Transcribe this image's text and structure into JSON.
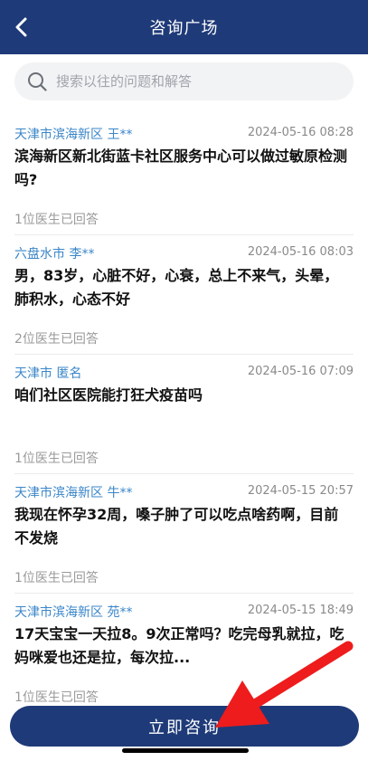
{
  "header": {
    "title": "咨询广场",
    "back_icon": "chevron-left-icon"
  },
  "search": {
    "placeholder": "搜索以往的问题和解答",
    "icon": "search-icon"
  },
  "questions": [
    {
      "location": "天津市滨海新区 王**",
      "time": "2024-05-16 08:28",
      "question": "滨海新区新北街蓝卡社区服务中心可以做过敏原检测吗?",
      "answers": "1位医生已回答"
    },
    {
      "location": "六盘水市 李**",
      "time": "2024-05-16 08:03",
      "question": "男，83岁，心脏不好，心衰，总上不来气，头晕，肺积水，心态不好",
      "answers": "2位医生已回答"
    },
    {
      "location": "天津市 匿名",
      "time": "2024-05-16 07:09",
      "question": "咱们社区医院能打狂犬疫苗吗",
      "answers": "1位医生已回答"
    },
    {
      "location": "天津市滨海新区 牛**",
      "time": "2024-05-15 20:57",
      "question": "我现在怀孕32周，嗓子肿了可以吃点啥药啊，目前不发烧",
      "answers": "1位医生已回答"
    },
    {
      "location": "天津市滨海新区 苑**",
      "time": "2024-05-15 18:49",
      "question": "17天宝宝一天拉8。9次正常吗？吃完母乳就拉，吃妈咪爱也还是拉，每次拉...",
      "answers": "1位医生已回答"
    }
  ],
  "cta": {
    "label": "立即咨询"
  },
  "colors": {
    "primary": "#1e3a78",
    "location": "#3a86c8",
    "annotation_arrow": "#ee1c1c"
  }
}
